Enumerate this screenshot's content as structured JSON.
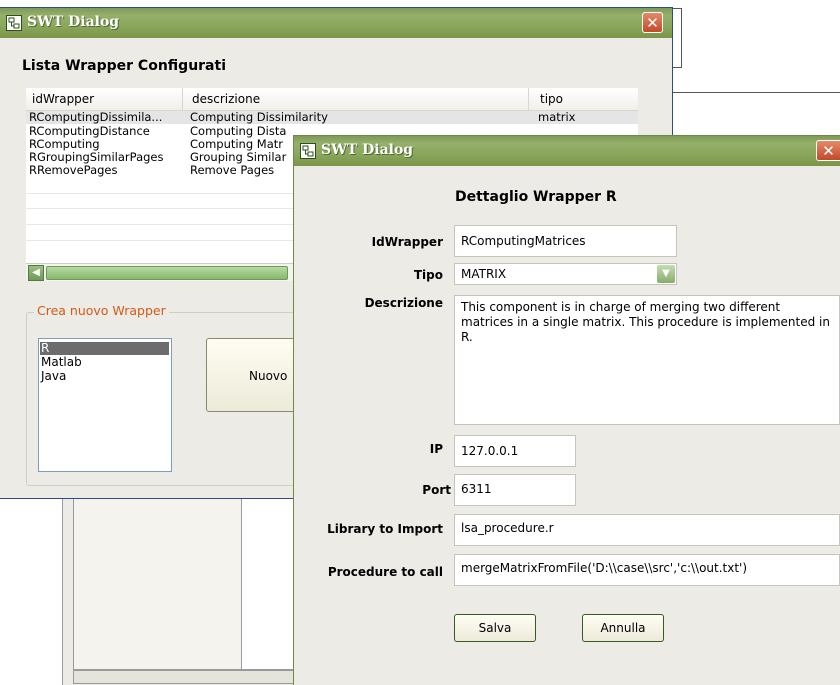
{
  "dialog1": {
    "title": "SWT Dialog",
    "heading": "Lista Wrapper Configurati",
    "columns": [
      "idWrapper",
      "descrizione",
      "tipo"
    ],
    "rows": [
      {
        "id": "RComputingDissimila...",
        "desc": "Computing Dissimilarity",
        "tipo": "matrix"
      },
      {
        "id": "RComputingDistance",
        "desc": "Computing Dista",
        "tipo": ""
      },
      {
        "id": "RComputing",
        "desc": "Computing Matr",
        "tipo": ""
      },
      {
        "id": "RGroupingSimilarPages",
        "desc": "Grouping Similar",
        "tipo": ""
      },
      {
        "id": "RRemovePages",
        "desc": "Remove Pages",
        "tipo": ""
      }
    ],
    "group_title": "Crea nuovo Wrapper",
    "languages": [
      "R",
      "Matlab",
      "Java"
    ],
    "new_button": "Nuovo"
  },
  "dialog2": {
    "title": "SWT Dialog",
    "heading": "Dettaglio Wrapper R",
    "labels": {
      "id": "IdWrapper",
      "tipo": "Tipo",
      "descrizione": "Descrizione",
      "ip": "IP",
      "port": "Port",
      "library": "Library to Import",
      "procedure": "Procedure to call"
    },
    "values": {
      "id": "RComputingMatrices",
      "tipo": "MATRIX",
      "descrizione": "This component is in charge of merging two different matrices in a single matrix. This procedure is implemented in R.",
      "ip": "127.0.0.1",
      "port": "6311",
      "library": "lsa_procedure.r",
      "procedure": "mergeMatrixFromFile('D:\\\\case\\\\src','c:\\\\out.txt')"
    },
    "save_button": "Salva",
    "cancel_button": "Annulla"
  },
  "icons": {
    "app": "swt-app-icon",
    "close": "close-icon",
    "dropdown": "chevron-down-icon",
    "scroll_left": "scroll-left-arrow-icon"
  },
  "colors": {
    "titlebar": "#8aa75c",
    "dialog_bg": "#ecebe6",
    "group_title": "#d35a14",
    "close_button": "#c24a2a"
  }
}
